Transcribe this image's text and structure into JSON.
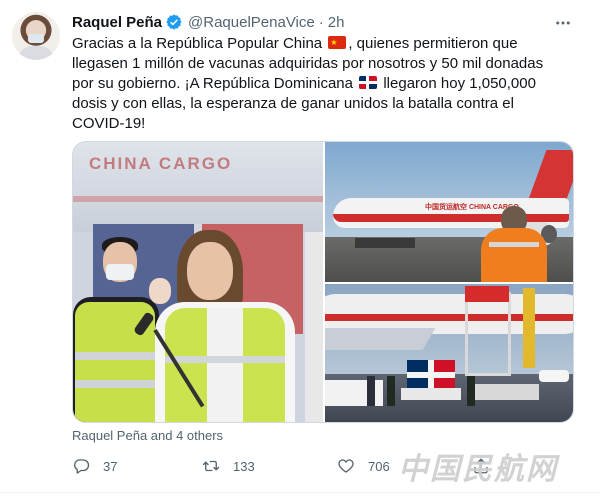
{
  "tweet": {
    "author_name": "Raquel Peña",
    "verified_icon": "verified-badge-icon",
    "handle": "@RaquelPenaVice",
    "separator": "·",
    "time": "2h",
    "more_icon": "more-horizontal-icon",
    "body": {
      "l1_a": "Gracias a la República Popular China",
      "l1_b": ", quienes permitieron que",
      "l2": "llegasen 1 millón de vacunas adquiridas por nosotros y 50 mil donadas",
      "l3": "por su gobierno. ¡A República Dominicana",
      "l3_b": " llegaron hoy 1,050,000",
      "l4": "dosis y con ellas, la esperanza de ganar unidos la batalla contra el",
      "l5": "COVID-19!"
    },
    "photo_text": {
      "cargo": "CHINA CARGO",
      "plane_label": "中国货运航空 CHINA CARGO"
    },
    "tagged": "Raquel Peña and 4 others",
    "actions": {
      "reply_icon": "reply-icon",
      "reply_count": "37",
      "retweet_icon": "retweet-icon",
      "retweet_count": "133",
      "like_icon": "heart-icon",
      "like_count": "706",
      "share_icon": "share-icon"
    },
    "watermark": "中国民航网",
    "colors": {
      "text": "#0f1419",
      "secondary": "#536471",
      "verified": "#1d9bf0"
    }
  }
}
